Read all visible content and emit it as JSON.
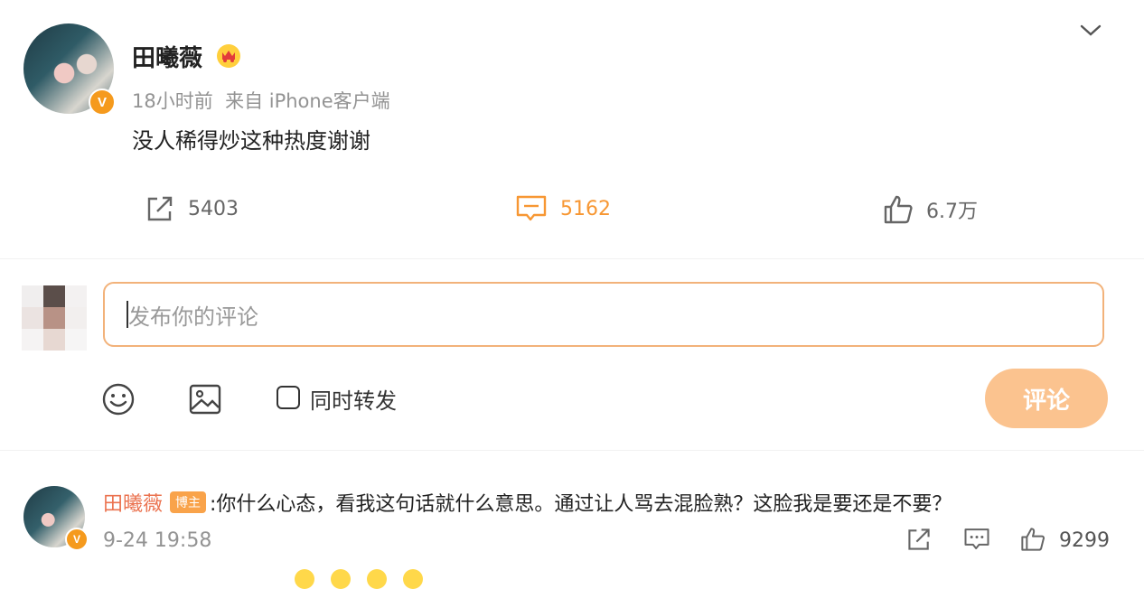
{
  "post": {
    "username": "田曦薇",
    "verified_badge": "V",
    "meta": "18小时前  来自 iPhone客户端",
    "content": "没人稀得炒这种热度谢谢",
    "stats": {
      "repost": "5403",
      "comment": "5162",
      "like": "6.7万"
    }
  },
  "composer": {
    "placeholder": "发布你的评论",
    "repost_label": "同时转发",
    "submit_label": "评论"
  },
  "comment": {
    "author": "田曦薇",
    "tag": "博主",
    "text": ":你什么心态，看我这句话就什么意思。通过让人骂去混脸熟？这脸我是要还是不要？",
    "time": "9-24 19:58",
    "like_count": "9299",
    "verified_badge": "V"
  },
  "colors": {
    "accent": "#f79733",
    "verified": "#f59a1d",
    "name_link": "#eb7350",
    "submit_disabled": "#fbc38f",
    "input_border": "#f2b27a"
  },
  "icons": [
    "chevron-down-icon",
    "crown-icon",
    "repost-icon",
    "comment-icon",
    "like-icon",
    "emoji-icon",
    "image-icon",
    "checkbox"
  ]
}
